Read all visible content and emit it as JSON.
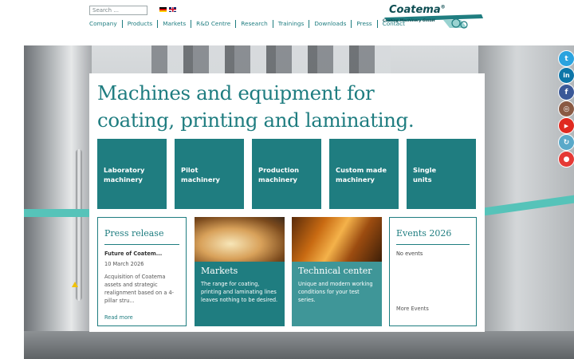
{
  "header": {
    "search_placeholder": "Search ...",
    "nav": [
      "Company",
      "Products",
      "Markets",
      "R&D Centre",
      "Research",
      "Trainings",
      "Downloads",
      "Press",
      "Contact"
    ],
    "logo_name": "Coatema",
    "logo_mark": "®",
    "logo_tagline": "Coating Machinery GmbH"
  },
  "hero": {
    "headline_line1": "Machines and equipment for",
    "headline_line2": "coating, printing and laminating."
  },
  "tiles": [
    {
      "line1": "Laboratory",
      "line2": "machinery"
    },
    {
      "line1": "Pilot",
      "line2": "machinery"
    },
    {
      "line1": "Production",
      "line2": "machinery"
    },
    {
      "line1": "Custom made",
      "line2": "machinery"
    },
    {
      "line1": "Single",
      "line2": "units"
    }
  ],
  "press": {
    "title": "Press release",
    "article_title": "Future of Coatem...",
    "date": "10 March 2026",
    "text": "Acquisition of Coatema assets and strategic realignment based on a 4-pillar stru...",
    "read_more": "Read more"
  },
  "markets": {
    "title": "Markets",
    "text": "The range for coating, printing and laminating lines leaves nothing to be desired."
  },
  "technical": {
    "title": "Technical center",
    "text": "Unique and modern working conditions for your test series."
  },
  "events": {
    "title": "Events 2026",
    "empty": "No events",
    "more": "More Events"
  },
  "social": [
    {
      "icon": "twitter-icon",
      "glyph": "t",
      "color": "#2aa3df"
    },
    {
      "icon": "linkedin-icon",
      "glyph": "in",
      "color": "#0e76a8"
    },
    {
      "icon": "facebook-icon",
      "glyph": "f",
      "color": "#3b5998"
    },
    {
      "icon": "instagram-icon",
      "glyph": "◎",
      "color": "#8a5a44"
    },
    {
      "icon": "youtube-icon",
      "glyph": "▶",
      "color": "#e02a20"
    },
    {
      "icon": "refresh-icon",
      "glyph": "↻",
      "color": "#5aa9c9"
    },
    {
      "icon": "chat-icon",
      "glyph": "●",
      "color": "#e53935"
    }
  ],
  "colors": {
    "accent": "#1f7d80",
    "accent_light": "#3f9698"
  }
}
